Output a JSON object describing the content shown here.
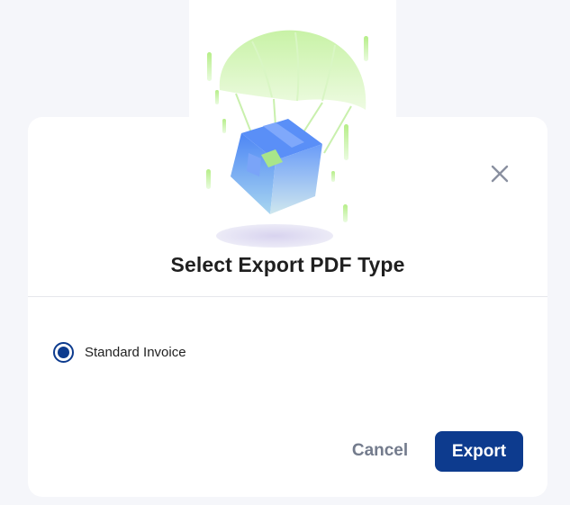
{
  "dialog": {
    "title": "Select Export PDF Type",
    "options": [
      {
        "label": "Standard Invoice",
        "selected": true
      }
    ],
    "cancel_label": "Cancel",
    "export_label": "Export",
    "close_icon": "close-icon",
    "illustration_icon": "parachute-package-illustration"
  },
  "colors": {
    "page_background": "#f5f6fa",
    "modal_background": "#ffffff",
    "primary": "#0d3b8e",
    "title_text": "#1f1f1f",
    "muted_text": "#737b8c",
    "close_icon": "#8a90a0",
    "divider": "#e6e7ec"
  }
}
